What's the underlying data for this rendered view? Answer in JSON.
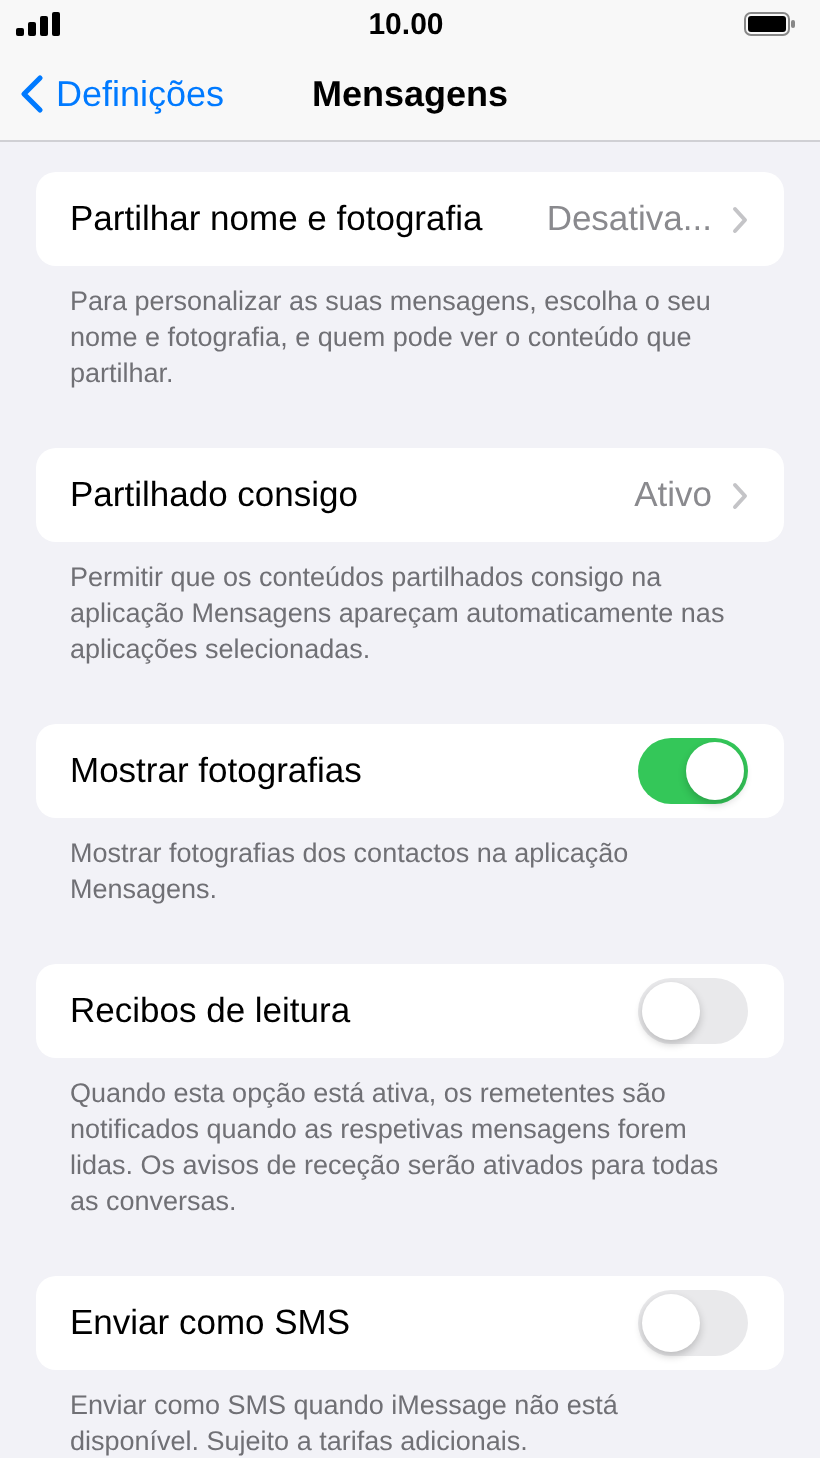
{
  "status_bar": {
    "time": "10.00"
  },
  "nav": {
    "back": "Definições",
    "title": "Mensagens"
  },
  "sections": [
    {
      "row": {
        "kind": "link",
        "label": "Partilhar nome e fotografia",
        "value": "Desativa..."
      },
      "footer": "Para personalizar as suas mensagens, escolha o seu nome e fotografia, e quem pode ver o conteúdo que partilhar."
    },
    {
      "row": {
        "kind": "link",
        "label": "Partilhado consigo",
        "value": "Ativo"
      },
      "footer": "Permitir que os conteúdos partilhados consigo na aplicação Mensagens apareçam automaticamente nas aplicações selecionadas."
    },
    {
      "row": {
        "kind": "toggle",
        "label": "Mostrar fotografias",
        "on": true
      },
      "footer": "Mostrar fotografias dos contactos na aplicação Mensagens."
    },
    {
      "row": {
        "kind": "toggle",
        "label": "Recibos de leitura",
        "on": false
      },
      "footer": "Quando esta opção está ativa, os remetentes são notificados quando as respetivas mensagens forem lidas. Os avisos de receção serão ativados para todas as conversas."
    },
    {
      "row": {
        "kind": "toggle",
        "label": "Enviar como SMS",
        "on": false
      },
      "footer": "Enviar como SMS quando iMessage não está disponível. Sujeito a tarifas adicionais."
    }
  ]
}
